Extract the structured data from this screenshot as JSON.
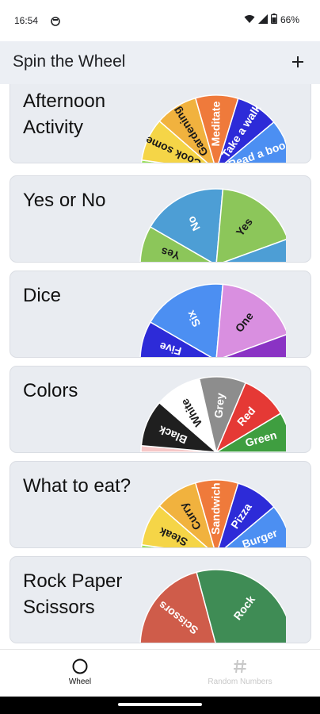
{
  "status_bar": {
    "time": "16:54",
    "battery": "66%"
  },
  "app_bar": {
    "title": "Spin the Wheel"
  },
  "colors": {
    "card_bg": "#e9ecf1",
    "app_bar_bg": "#eceff4",
    "nav_active": "#111111",
    "nav_inactive": "#c8c8c8"
  },
  "wheels": [
    {
      "title": "Afternoon Activity",
      "segments": [
        {
          "label": "",
          "color": "#9be15d"
        },
        {
          "label": "Cook some",
          "color": "#f5d547"
        },
        {
          "label": "Gardening",
          "color": "#f1b23e"
        },
        {
          "label": "Meditate",
          "color": "#ef7a3b"
        },
        {
          "label": "Take a walk",
          "color": "#2d2bd8"
        },
        {
          "label": "Read a book",
          "color": "#4c8ff2"
        }
      ]
    },
    {
      "title": "Yes or No",
      "segments": [
        {
          "label": "Yes",
          "color": "#8cc65a"
        },
        {
          "label": "No",
          "color": "#4d9ed5"
        },
        {
          "label": "Yes",
          "color": "#8cc65a"
        },
        {
          "label": "",
          "color": "#4d9ed5"
        }
      ]
    },
    {
      "title": "Dice",
      "segments": [
        {
          "label": "Five",
          "color": "#2d2bd8"
        },
        {
          "label": "Six",
          "color": "#4c8ff2"
        },
        {
          "label": "One",
          "color": "#d98fe0"
        },
        {
          "label": "",
          "color": "#8a33c4"
        }
      ]
    },
    {
      "title": "Colors",
      "segments": [
        {
          "label": "",
          "color": "#f6c7c7"
        },
        {
          "label": "Black",
          "color": "#1f1f1f"
        },
        {
          "label": "White",
          "color": "#ffffff"
        },
        {
          "label": "Grey",
          "color": "#8d8d8d"
        },
        {
          "label": "Red",
          "color": "#e53935"
        },
        {
          "label": "Green",
          "color": "#3f9e40"
        }
      ]
    },
    {
      "title": "What to eat?",
      "segments": [
        {
          "label": "",
          "color": "#9be15d"
        },
        {
          "label": "Steak",
          "color": "#f5d547"
        },
        {
          "label": "Curry",
          "color": "#f1b23e"
        },
        {
          "label": "Sandwich",
          "color": "#ef7a3b"
        },
        {
          "label": "Pizza",
          "color": "#2d2bd8"
        },
        {
          "label": "Burger",
          "color": "#4c8ff2"
        }
      ]
    },
    {
      "title": "Rock Paper Scissors",
      "segments": [
        {
          "label": "Scissors",
          "color": "#cf5c4a"
        },
        {
          "label": "Rock",
          "color": "#3f8c55"
        }
      ]
    }
  ],
  "bottom_nav": [
    {
      "label": "Wheel",
      "icon": "circle-icon",
      "active": true
    },
    {
      "label": "Random Numbers",
      "icon": "hash-icon",
      "active": false
    }
  ]
}
